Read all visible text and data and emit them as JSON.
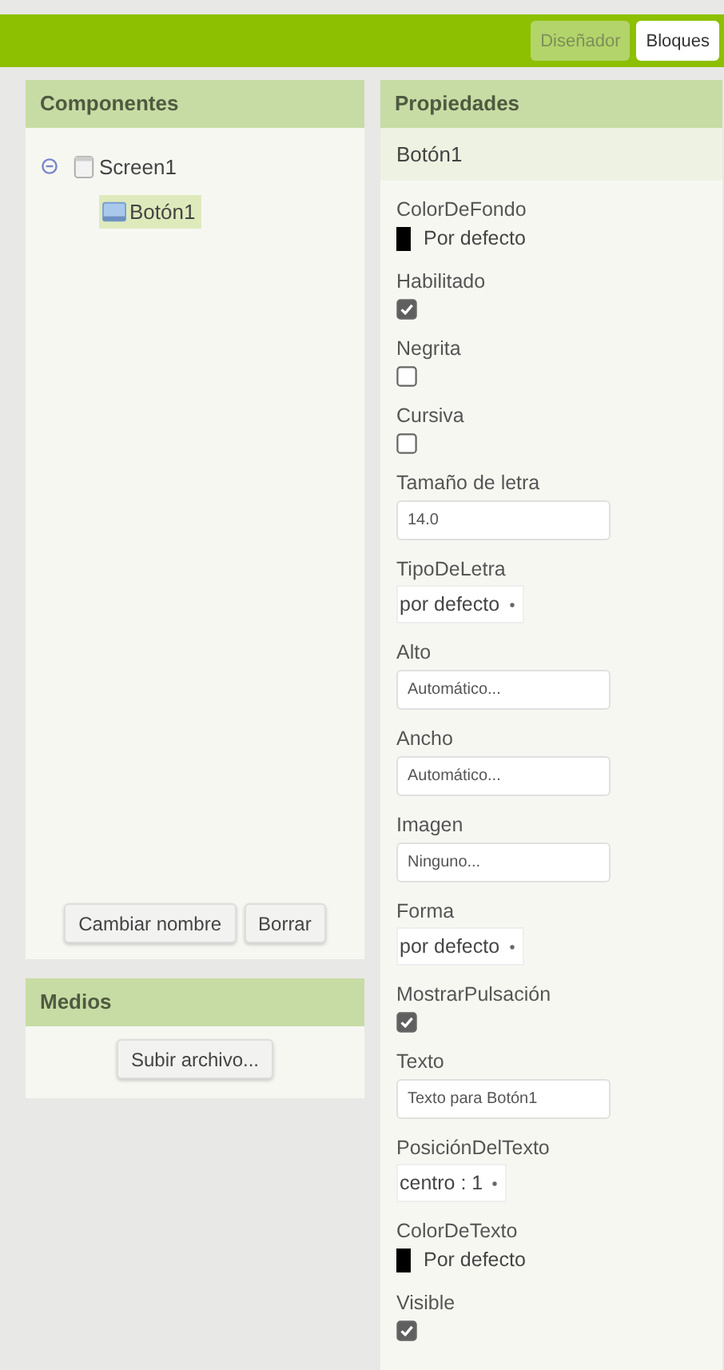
{
  "toolbar": {
    "tabs": [
      {
        "label": "Diseñador",
        "selected": true
      },
      {
        "label": "Bloques",
        "selected": false
      }
    ]
  },
  "components": {
    "title": "Componentes",
    "tree": [
      {
        "label": "Screen1",
        "expanded": true,
        "selected": false,
        "children": [
          {
            "label": "Botón1",
            "selected": true
          }
        ]
      }
    ],
    "buttons": [
      "Cambiar nombre",
      "Borrar"
    ]
  },
  "media": {
    "title": "Medios",
    "button": "Subir archivo..."
  },
  "properties": {
    "title": "Propiedades",
    "component": "Botón1",
    "items": [
      {
        "kind": "color",
        "label": "ColorDeFondo",
        "value": "Por defecto",
        "color": "#000000"
      },
      {
        "kind": "checkbox",
        "label": "Habilitado",
        "checked": true
      },
      {
        "kind": "checkbox",
        "label": "Negrita",
        "checked": false
      },
      {
        "kind": "checkbox",
        "label": "Cursiva",
        "checked": false
      },
      {
        "kind": "text",
        "label": "Tamaño de letra",
        "value": "14.0"
      },
      {
        "kind": "dropdown",
        "label": "TipoDeLetra",
        "value": "por defecto"
      },
      {
        "kind": "text",
        "label": "Alto",
        "value": "Automático..."
      },
      {
        "kind": "text",
        "label": "Ancho",
        "value": "Automático..."
      },
      {
        "kind": "text",
        "label": "Imagen",
        "value": "Ninguno..."
      },
      {
        "kind": "dropdown",
        "label": "Forma",
        "value": "por defecto"
      },
      {
        "kind": "checkbox",
        "label": "MostrarPulsación",
        "checked": true
      },
      {
        "kind": "text",
        "label": "Texto",
        "value": "Texto para Botón1"
      },
      {
        "kind": "dropdown",
        "label": "PosiciónDelTexto",
        "value": "centro : 1"
      },
      {
        "kind": "color",
        "label": "ColorDeTexto",
        "value": "Por defecto",
        "color": "#000000"
      },
      {
        "kind": "checkbox",
        "label": "Visible",
        "checked": true
      }
    ]
  }
}
